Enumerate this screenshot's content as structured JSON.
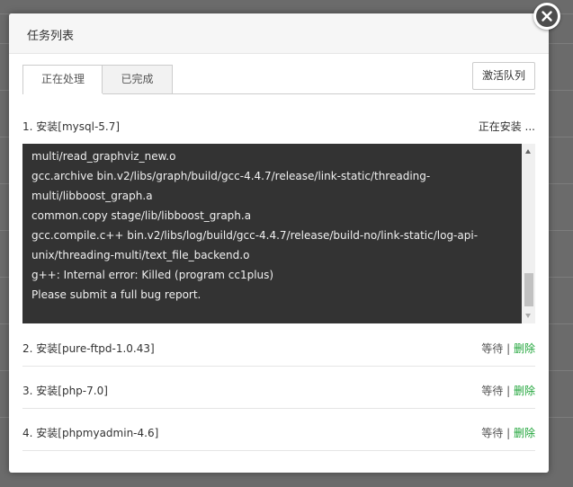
{
  "dialog": {
    "title": "任务列表",
    "tabs": [
      {
        "label": "正在处理"
      },
      {
        "label": "已完成"
      }
    ],
    "activate_button": "激活队列"
  },
  "tasks": [
    {
      "title": "1. 安装[mysql-5.7]",
      "status": "正在安装 ...",
      "log": [
        "multi/read_graphviz_new.o",
        "gcc.archive bin.v2/libs/graph/build/gcc-4.4.7/release/link-static/threading-",
        "multi/libboost_graph.a",
        "common.copy stage/lib/libboost_graph.a",
        "gcc.compile.c++ bin.v2/libs/log/build/gcc-4.4.7/release/build-no/link-static/log-api-",
        "unix/threading-multi/text_file_backend.o",
        "g++: Internal error: Killed (program cc1plus)",
        "Please submit a full bug report."
      ]
    },
    {
      "title": "2. 安装[pure-ftpd-1.0.43]",
      "wait": "等待",
      "sep": "|",
      "delete": "删除"
    },
    {
      "title": "3. 安装[php-7.0]",
      "wait": "等待",
      "sep": "|",
      "delete": "删除"
    },
    {
      "title": "4. 安装[phpmyadmin-4.6]",
      "wait": "等待",
      "sep": "|",
      "delete": "删除"
    }
  ],
  "icons": {
    "close": "close-icon"
  },
  "colors": {
    "delete_link": "#20a53a",
    "log_background": "#333333"
  }
}
